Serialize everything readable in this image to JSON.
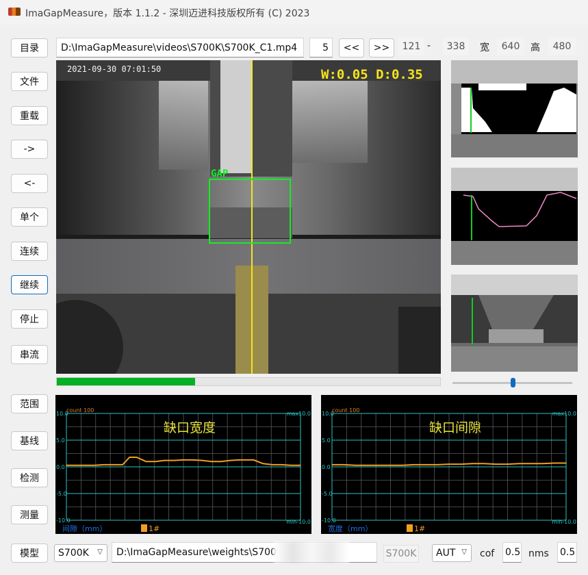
{
  "window": {
    "title": "ImaGapMeasure，版本 1.1.2 - 深圳迈进科技版权所有 (C) 2023"
  },
  "sidebar": {
    "items": [
      "目录",
      "文件",
      "重载",
      "->",
      "<-",
      "单个",
      "连续",
      "继续",
      "停止",
      "串流"
    ],
    "lower_items": [
      "范围",
      "基线",
      "检测",
      "测量"
    ],
    "focused_item": "继续"
  },
  "toolbar": {
    "path_value": "D:\\ImaGapMeasure\\videos\\S700K\\S700K_C1.mp4",
    "step_value": "5",
    "prev_label": "<<",
    "next_label": ">>",
    "frame_current": "121",
    "frame_sep": "-",
    "frame_total": "338",
    "width_label": "宽",
    "width_value": "640",
    "height_label": "高",
    "height_value": "480"
  },
  "video": {
    "timestamp": "2021-09-30 07:01:50",
    "overlay_metrics": "W:0.05 D:0.35",
    "roi_label": "GAP",
    "overlay_color": "#f5e51b",
    "roi_color": "#11ee22"
  },
  "progress": {
    "fraction": 0.36,
    "color": "#06b025"
  },
  "slider": {
    "fraction": 0.5
  },
  "charts": [
    {
      "title": "缺口宽度",
      "count_label": "count 100",
      "max_label": "max10.0",
      "min_label": "min-10.0",
      "y_ticks": [
        "10.0",
        "5.0",
        "0.0",
        "-5.0",
        "-10.0"
      ],
      "axis_label": "间隙（mm）",
      "legend": "1#"
    },
    {
      "title": "缺口间隙",
      "count_label": "count 100",
      "max_label": "max10.0",
      "min_label": "min-10.0",
      "y_ticks": [
        "10.0",
        "5.0",
        "0.0",
        "-5.0",
        "-10.0"
      ],
      "axis_label": "宽度（mm）",
      "legend": "1#"
    }
  ],
  "chart_data": [
    {
      "type": "line",
      "title": "缺口宽度",
      "xlabel": "间隙（mm）",
      "ylim": [
        -10,
        10
      ],
      "x": [
        0,
        4,
        8,
        12,
        16,
        20,
        24,
        27,
        30,
        34,
        38,
        42,
        46,
        50,
        54,
        58,
        62,
        66,
        70,
        74,
        78,
        80,
        84,
        88,
        92,
        96,
        100
      ],
      "series": [
        {
          "name": "1#",
          "values": [
            0.3,
            0.3,
            0.3,
            0.3,
            0.4,
            0.4,
            0.4,
            1.8,
            1.8,
            1.0,
            1.0,
            1.2,
            1.2,
            1.3,
            1.3,
            1.2,
            1.0,
            1.0,
            1.2,
            1.3,
            1.3,
            1.3,
            0.6,
            0.4,
            0.4,
            0.3,
            0.3
          ]
        }
      ],
      "color": "#f0a020"
    },
    {
      "type": "line",
      "title": "缺口间隙",
      "xlabel": "宽度（mm）",
      "ylim": [
        -10,
        10
      ],
      "x": [
        0,
        5,
        10,
        15,
        20,
        25,
        30,
        35,
        40,
        45,
        50,
        55,
        60,
        65,
        70,
        75,
        80,
        85,
        90,
        95,
        100
      ],
      "series": [
        {
          "name": "1#",
          "values": [
            0.4,
            0.4,
            0.3,
            0.3,
            0.3,
            0.3,
            0.3,
            0.4,
            0.4,
            0.4,
            0.5,
            0.5,
            0.6,
            0.6,
            0.5,
            0.5,
            0.6,
            0.6,
            0.6,
            0.7,
            0.7
          ]
        }
      ],
      "color": "#f0a020"
    }
  ],
  "bottom": {
    "model_label": "模型",
    "model_select": "S700K",
    "weights_path": "D:\\ImaGapMeasure\\weights\\S700K_",
    "model_readonly": "S700K",
    "mode_select": "AUT",
    "cof_label": "cof",
    "cof_value": "0.5",
    "nms_label": "nms",
    "nms_value": "0.5"
  }
}
